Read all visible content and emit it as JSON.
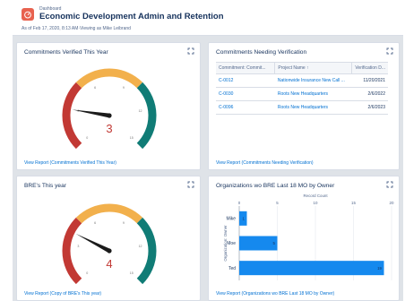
{
  "header": {
    "object_type": "Dashboard",
    "title": "Economic Development Admin and Retention",
    "subtitle": "As of Feb 17, 2020, 8:13 AM·Viewing as Mike Leibrand"
  },
  "cards": {
    "commitments_verified": {
      "title": "Commitments Verified This Year",
      "footer": "View Report (Commitments Verified This Year)",
      "gauge": {
        "value": 3,
        "value_label": "3",
        "min": 0,
        "max": 15,
        "ticks": [
          "0",
          "3",
          "6",
          "9",
          "12",
          "15"
        ],
        "bands": [
          5,
          10
        ],
        "colors": [
          "#c23934",
          "#f2b04c",
          "#107c76"
        ]
      }
    },
    "commitments_needing_verification": {
      "title": "Commitments Needing Verification",
      "footer": "View Report (Commitments Needing Verification)",
      "columns": [
        "Commitment: Commit...",
        "Project Name ↑",
        "Verification D..."
      ],
      "rows": [
        [
          "C-0012",
          "Nationwide Insurance New Call ...",
          "11/20/2021"
        ],
        [
          "C-0030",
          "Roots New Headquarters",
          "2/6/2022"
        ],
        [
          "C-0096",
          "Roots New Headquarters",
          "2/6/2023"
        ]
      ]
    },
    "bres_this_year": {
      "title": "BRE's This year",
      "footer": "View Report (Copy of BRE's This year)",
      "gauge": {
        "value": 4,
        "value_label": "4",
        "min": 0,
        "max": 15,
        "ticks": [
          "0",
          "3",
          "6",
          "9",
          "12",
          "15"
        ],
        "bands": [
          5,
          10
        ],
        "colors": [
          "#c23934",
          "#f2b04c",
          "#107c76"
        ]
      }
    },
    "orgs_bre_by_owner": {
      "title": "Organizations wo BRE Last 18 MO by Owner",
      "footer": "View Report (Organizations wo BRE Last 18 MO by Owner)"
    }
  },
  "chart_data": {
    "type": "bar",
    "orientation": "horizontal",
    "title": "",
    "xlabel": "Record Count",
    "ylabel": "Organization: Owner",
    "categories": [
      "Mike",
      "Moe",
      "Ted"
    ],
    "values": [
      1,
      5,
      19
    ],
    "xlim": [
      0,
      20
    ],
    "xticks": [
      "0",
      "5",
      "10",
      "15",
      "20"
    ],
    "bar_color": "#1589ee"
  }
}
